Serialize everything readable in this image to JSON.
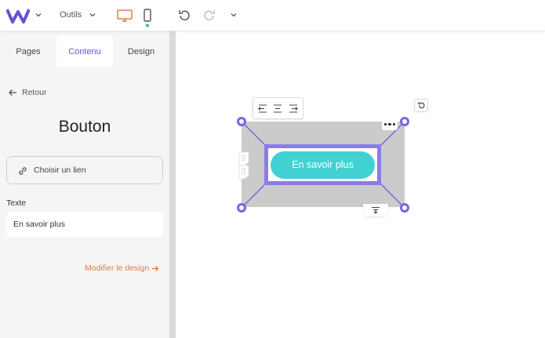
{
  "topbar": {
    "tools_label": "Outils"
  },
  "sidebar": {
    "tabs": [
      {
        "label": "Pages"
      },
      {
        "label": "Contenu"
      },
      {
        "label": "Design"
      }
    ],
    "active_tab": "Contenu",
    "back_label": "Retour",
    "title": "Bouton",
    "link_button_label": "Choisir un lien",
    "text_field": {
      "label": "Texte",
      "value": "En savoir plus"
    },
    "design_link_label": "Modifier le design"
  },
  "canvas": {
    "button_text": "En savoir plus"
  },
  "icons": {
    "logo": "w-logo-icon",
    "desktop": "desktop-icon",
    "mobile": "mobile-icon",
    "undo": "undo-icon",
    "redo": "redo-icon",
    "link": "link-icon",
    "back": "arrow-left-icon",
    "rotate": "rotate-icon",
    "more": "more-icon"
  },
  "colors": {
    "accent": "#6c4fd8",
    "desktop_active": "#e57a45",
    "mobile_indicator": "#2bbf7a",
    "button_fill": "#42d1d3",
    "selection": "#7c63e0"
  }
}
